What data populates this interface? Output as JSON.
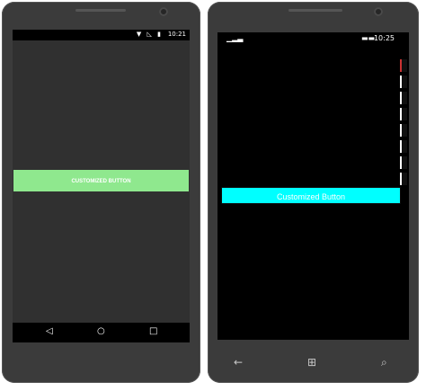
{
  "android": {
    "status_time": "10:21",
    "status_icons": "▼ ◺ ▮",
    "button_label": "CUSTOMIZED BUTTON",
    "nav_back": "◁",
    "nav_home": "○",
    "nav_recent": "□"
  },
  "windows": {
    "status_signal": "▁▂▃",
    "status_battery": "▬▬",
    "status_time": "10:25",
    "button_label": "Customized Button",
    "nav_back": "←",
    "nav_start": "⊞",
    "nav_search": "⌕"
  },
  "colors": {
    "android_button": "#8fe88e",
    "windows_button": "#00ffff",
    "phone_body": "#3b3b3b"
  }
}
